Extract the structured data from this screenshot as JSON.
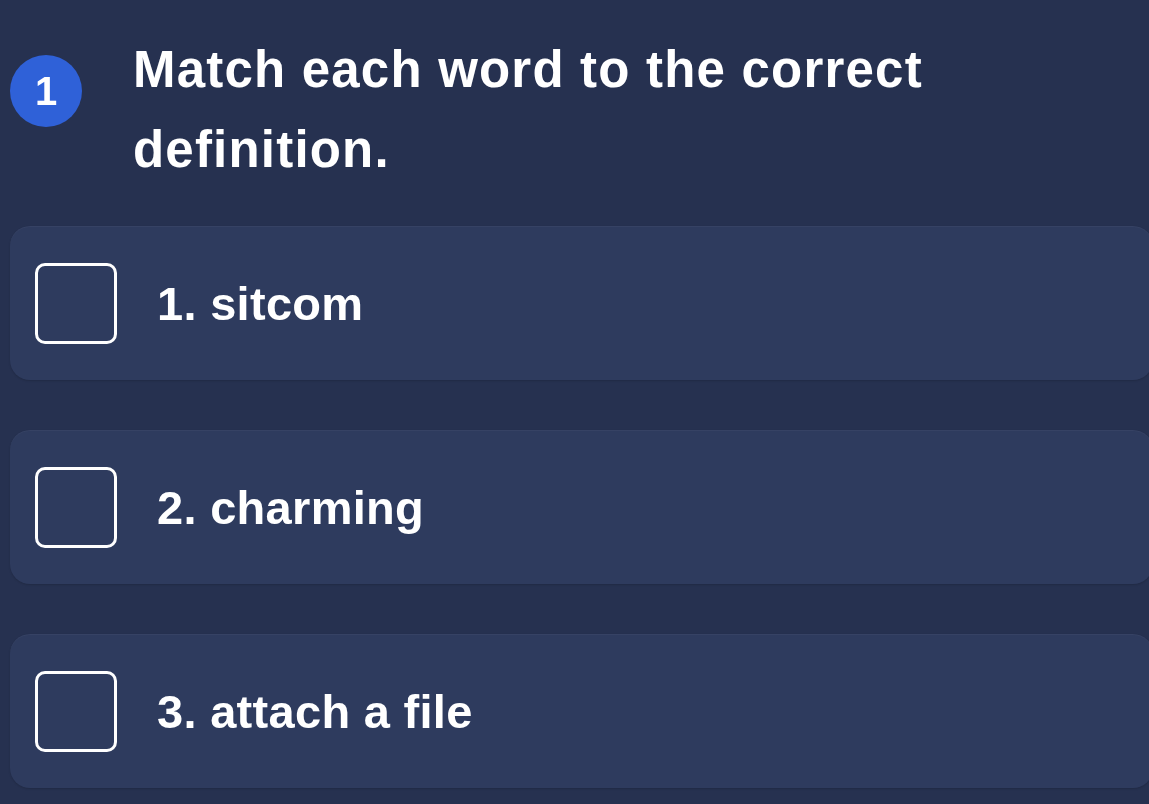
{
  "question": {
    "number": "1",
    "prompt": "Match each word to the correct definition."
  },
  "items": [
    {
      "label": "1. sitcom",
      "checked": false
    },
    {
      "label": "2. charming",
      "checked": false
    },
    {
      "label": "3. attach a file",
      "checked": false
    }
  ]
}
